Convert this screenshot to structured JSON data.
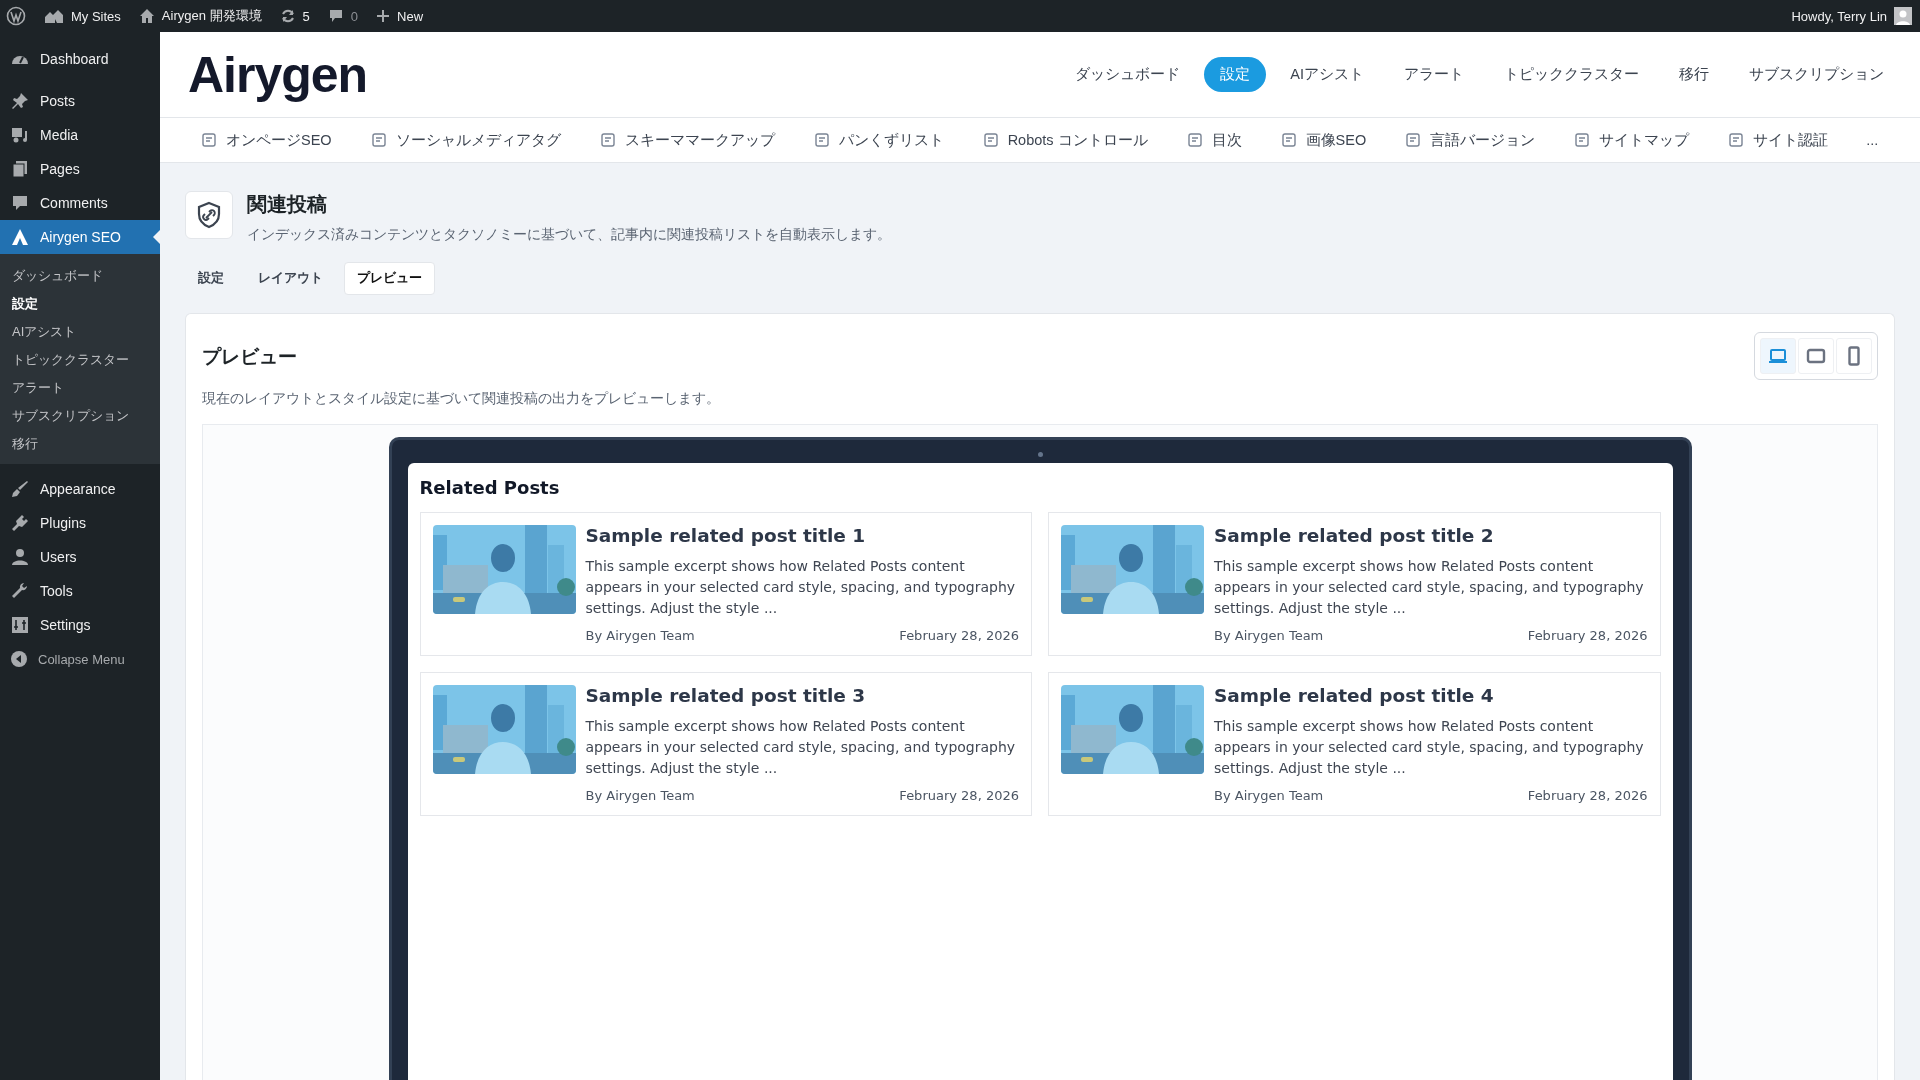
{
  "admin_bar": {
    "items": [
      {
        "kind": "wp"
      },
      {
        "kind": "sites",
        "label": "My Sites"
      },
      {
        "kind": "home",
        "label": "Airygen 開発環境"
      },
      {
        "kind": "updates",
        "label": "5"
      },
      {
        "kind": "comments",
        "label": "0"
      },
      {
        "kind": "new",
        "label": "New"
      }
    ],
    "user": "Howdy, Terry Lin"
  },
  "sidebar": {
    "items": [
      {
        "label": "Dashboard",
        "selected": false
      },
      {
        "label": "Posts",
        "selected": false
      },
      {
        "label": "Media",
        "selected": false
      },
      {
        "label": "Pages",
        "selected": false
      },
      {
        "label": "Comments",
        "selected": false
      },
      {
        "label": "Airygen SEO",
        "selected": true,
        "children": [
          {
            "label": "ダッシュボード",
            "selected": false
          },
          {
            "label": "設定",
            "selected": true
          },
          {
            "label": "AIアシスト",
            "selected": false
          },
          {
            "label": "トピッククラスター",
            "selected": false
          },
          {
            "label": "アラート",
            "selected": false
          },
          {
            "label": "サブスクリプション",
            "selected": false
          },
          {
            "label": "移行",
            "selected": false
          }
        ]
      },
      {
        "label": "Appearance",
        "selected": false
      },
      {
        "label": "Plugins",
        "selected": false
      },
      {
        "label": "Users",
        "selected": false
      },
      {
        "label": "Tools",
        "selected": false
      },
      {
        "label": "Settings",
        "selected": false
      }
    ],
    "collapse": "Collapse Menu"
  },
  "header": {
    "logo": "Airygen",
    "nav": [
      {
        "label": "ダッシュボード",
        "selected": false
      },
      {
        "label": "設定",
        "selected": true
      },
      {
        "label": "AIアシスト",
        "selected": false
      },
      {
        "label": "アラート",
        "selected": false
      },
      {
        "label": "トピッククラスター",
        "selected": false
      },
      {
        "label": "移行",
        "selected": false
      },
      {
        "label": "サブスクリプション",
        "selected": false
      }
    ]
  },
  "subnav": {
    "items": [
      "オンページSEO",
      "ソーシャルメディアタグ",
      "スキーママークアップ",
      "パンくずリスト",
      "Robots コントロール",
      "目次",
      "画像SEO",
      "言語バージョン",
      "サイトマップ",
      "サイト認証"
    ],
    "more": "..."
  },
  "page": {
    "title": "関連投稿",
    "description": "インデックス済みコンテンツとタクソノミーに基づいて、記事内に関連投稿リストを自動表示します。",
    "tabs": [
      {
        "label": "設定",
        "selected": false
      },
      {
        "label": "レイアウト",
        "selected": false
      },
      {
        "label": "プレビュー",
        "selected": true
      }
    ]
  },
  "preview": {
    "title": "プレビュー",
    "description": "現在のレイアウトとスタイル設定に基づいて関連投稿の出力をプレビューします。",
    "devices": [
      {
        "selected": true
      },
      {
        "selected": false
      },
      {
        "selected": false
      }
    ],
    "heading": "Related Posts",
    "posts": [
      {
        "title": "Sample related post title 1",
        "excerpt": "This sample excerpt shows how Related Posts content appears in your selected card style, spacing, and typography settings. Adjust the style ...",
        "author": "By Airygen Team",
        "date": "February 28, 2026"
      },
      {
        "title": "Sample related post title 2",
        "excerpt": "This sample excerpt shows how Related Posts content appears in your selected card style, spacing, and typography settings. Adjust the style ...",
        "author": "By Airygen Team",
        "date": "February 28, 2026"
      },
      {
        "title": "Sample related post title 3",
        "excerpt": "This sample excerpt shows how Related Posts content appears in your selected card style, spacing, and typography settings. Adjust the style ...",
        "author": "By Airygen Team",
        "date": "February 28, 2026"
      },
      {
        "title": "Sample related post title 4",
        "excerpt": "This sample excerpt shows how Related Posts content appears in your selected card style, spacing, and typography settings. Adjust the style ...",
        "author": "By Airygen Team",
        "date": "February 28, 2026"
      }
    ]
  }
}
